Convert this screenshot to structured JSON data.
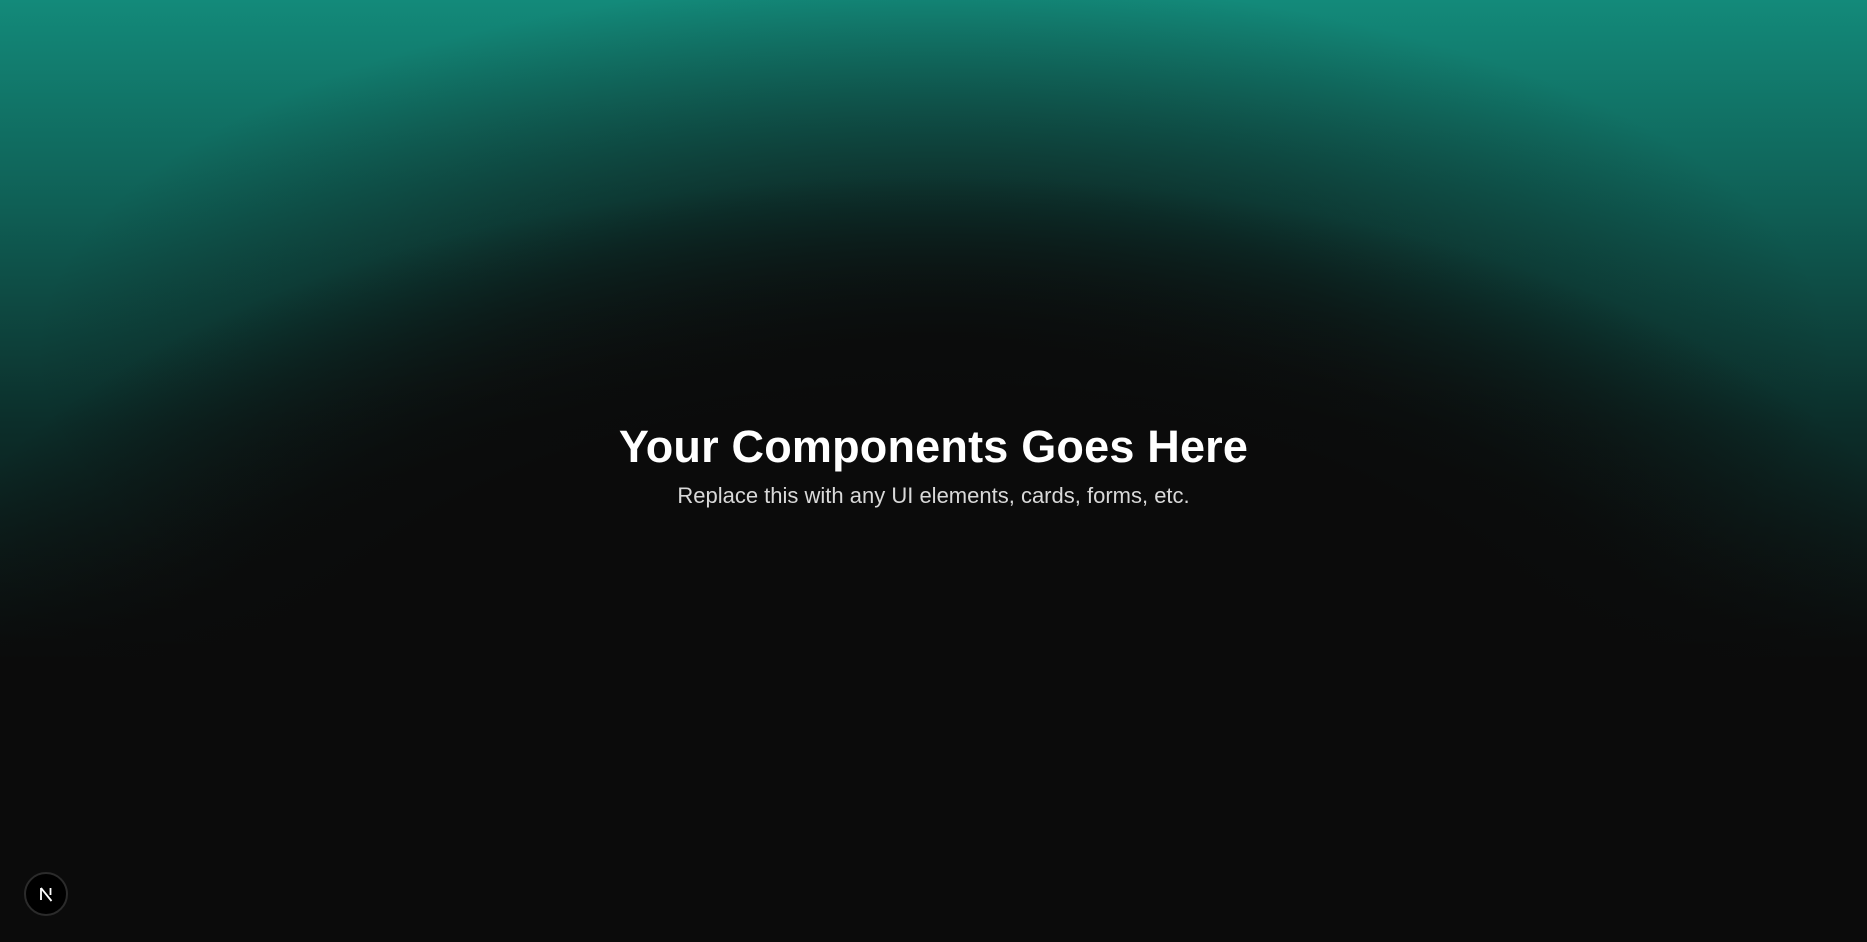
{
  "page": {
    "background_color": "#0b0b0b",
    "accent_color": "#138a7a"
  },
  "hero": {
    "title": "Your Components Goes Here",
    "subtitle": "Replace this with any UI elements, cards, forms, etc."
  },
  "dev_indicator": {
    "icon": "nextjs-logo-icon"
  }
}
